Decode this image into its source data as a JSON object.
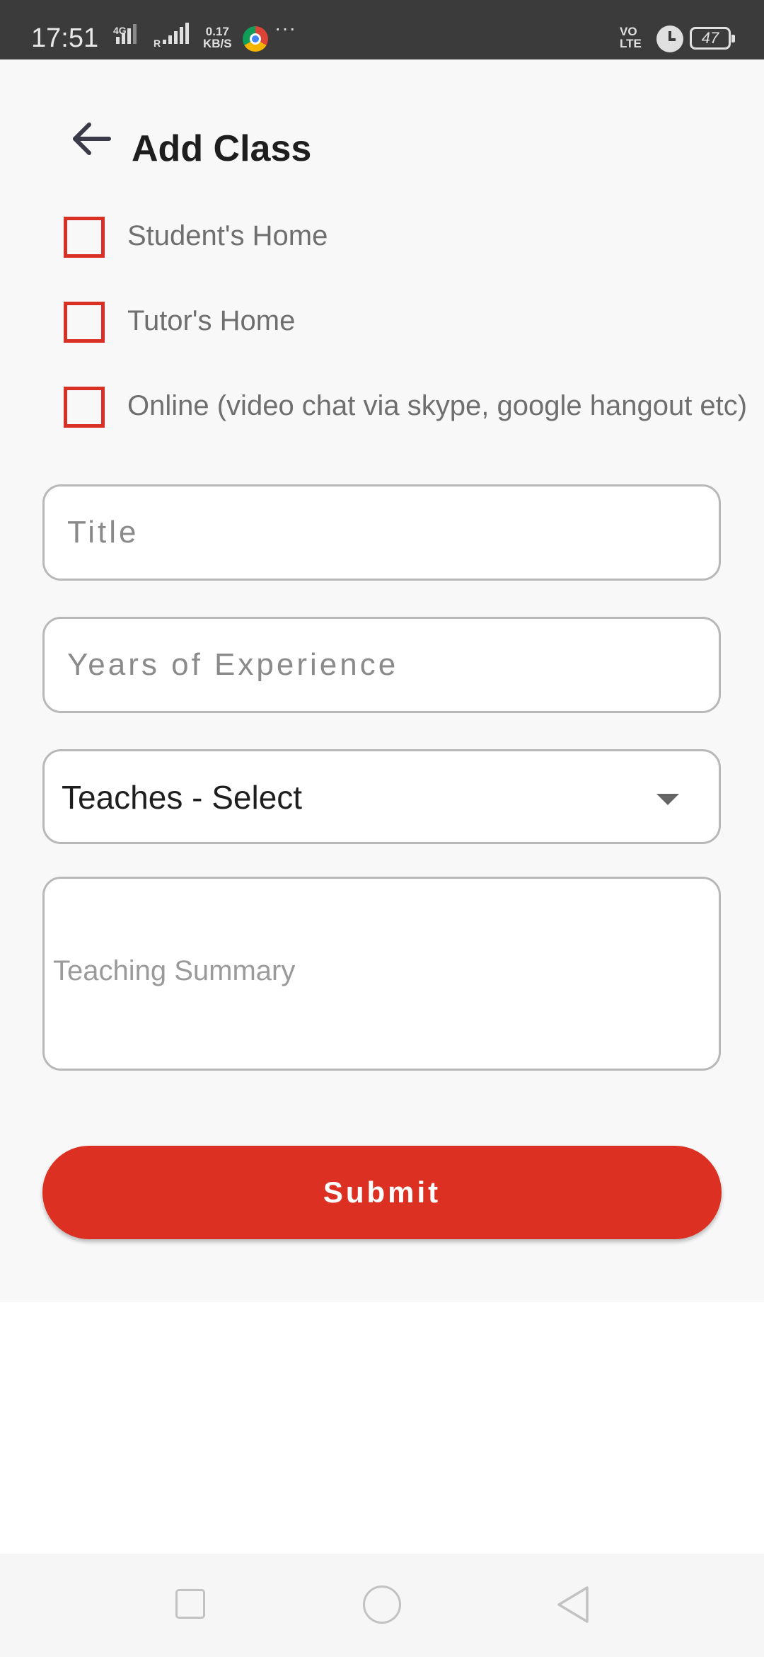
{
  "status_bar": {
    "time": "17:51",
    "network_1": "4G",
    "roaming": "R",
    "speed_value": "0.17",
    "speed_unit": "KB/S",
    "overflow": "···",
    "volte_top": "VO",
    "volte_bottom": "LTE",
    "battery": "47"
  },
  "header": {
    "title": "Add Class",
    "back_icon": "arrow-left-icon"
  },
  "locations": [
    {
      "label": "Student's Home",
      "checked": false
    },
    {
      "label": "Tutor's Home",
      "checked": false
    },
    {
      "label": "Online (video chat via skype, google hangout etc)",
      "checked": false
    }
  ],
  "form": {
    "title_placeholder": "Title",
    "experience_placeholder": "Years of Experience",
    "teaches_value": "Teaches - Select",
    "summary_placeholder": "Teaching Summary",
    "submit_label": "Submit"
  },
  "colors": {
    "accent": "#dc3022",
    "checkbox_border": "#d93025",
    "status_bar": "#3b3b3b",
    "app_background": "#f8f8f8"
  },
  "nav": {
    "recents_icon": "square-icon",
    "home_icon": "circle-icon",
    "back_icon": "triangle-back-icon"
  }
}
